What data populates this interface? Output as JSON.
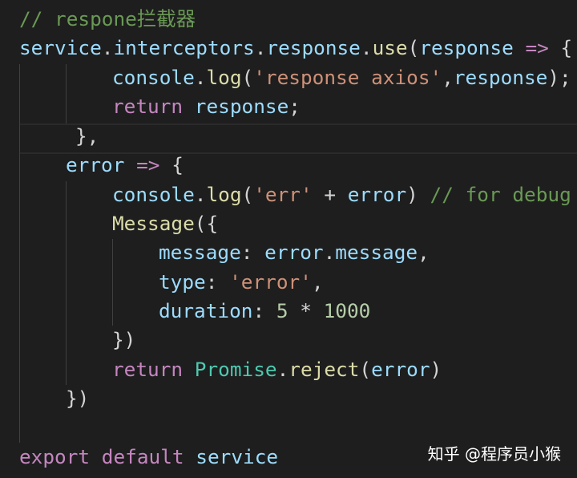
{
  "colors": {
    "background": "#1e1e1e",
    "comment": "#6a9955",
    "keyword": "#c586c0",
    "function": "#dcdcaa",
    "variable": "#9cdcfe",
    "string": "#ce9178",
    "number": "#b5cea8",
    "type": "#4ec9b0",
    "punctuation": "#d4d4d4"
  },
  "code": {
    "l1": {
      "comment": "// respone拦截器"
    },
    "l2": {
      "service": "service",
      "dot1": ".",
      "interceptors": "interceptors",
      "dot2": ".",
      "response": "response",
      "dot3": ".",
      "use": "use",
      "open": "(",
      "param": "response",
      "arrow": " => ",
      "brace": "{"
    },
    "l3": {
      "console": "console",
      "dot": ".",
      "log": "log",
      "open": "(",
      "str": "'response axios'",
      "comma": ",",
      "arg": "response",
      "close": ");"
    },
    "l4": {
      "kw": "return",
      "space": " ",
      "arg": "response",
      "semi": ";"
    },
    "l5": {
      "text": "},"
    },
    "l6": {
      "error": "error",
      "arrow": " => ",
      "brace": "{"
    },
    "l7": {
      "console": "console",
      "dot": ".",
      "log": "log",
      "open": "(",
      "str": "'err'",
      "plus": " + ",
      "arg": "error",
      "close": ") ",
      "comment": "// for debug"
    },
    "l8": {
      "fn": "Message",
      "open": "({"
    },
    "l9": {
      "key": "message",
      "colon": ": ",
      "obj": "error",
      "dot": ".",
      "prop": "message",
      "comma": ","
    },
    "l10": {
      "key": "type",
      "colon": ": ",
      "str": "'error'",
      "comma": ","
    },
    "l11": {
      "key": "duration",
      "colon": ": ",
      "n1": "5",
      "op": " * ",
      "n2": "1000"
    },
    "l12": {
      "text": "})"
    },
    "l13": {
      "kw": "return",
      "space": " ",
      "cls": "Promise",
      "dot": ".",
      "fn": "reject",
      "open": "(",
      "arg": "error",
      "close": ")"
    },
    "l14": {
      "text": "})"
    },
    "l16": {
      "kw1": "export",
      "kw2": "default",
      "arg": "service"
    }
  },
  "watermark": "知乎 @程序员小猴"
}
